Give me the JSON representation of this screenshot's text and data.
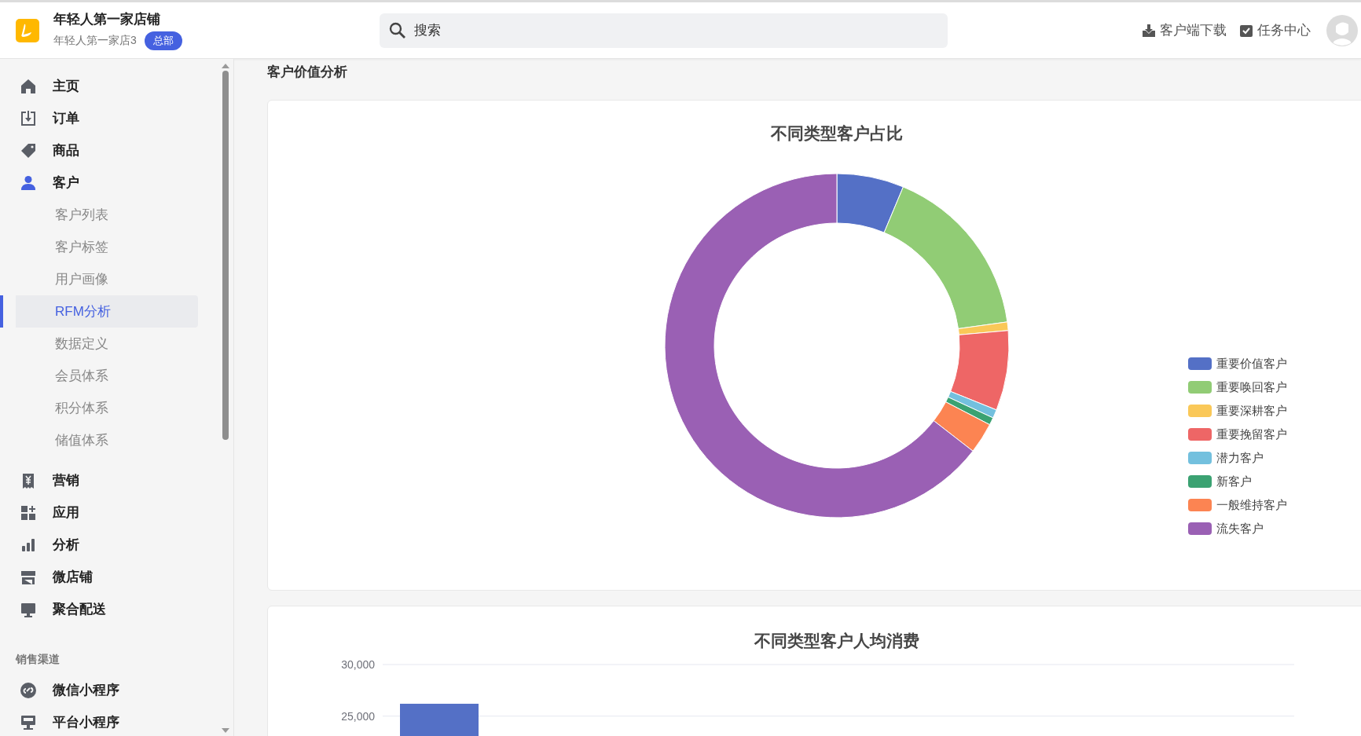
{
  "header": {
    "store_name": "年轻人第一家店铺",
    "branch": "年轻人第一家店3",
    "badge": "总部",
    "search": {
      "placeholder": "搜索"
    },
    "actions": [
      {
        "label": "客户端下载"
      },
      {
        "label": "任务中心"
      }
    ]
  },
  "sidebar": {
    "items": [
      {
        "label": "主页",
        "selected": false
      },
      {
        "label": "订单",
        "selected": false
      },
      {
        "label": "商品",
        "selected": false
      },
      {
        "label": "客户",
        "selected": false,
        "children": [
          {
            "label": "客户列表",
            "selected": false
          },
          {
            "label": "客户标签",
            "selected": false
          },
          {
            "label": "用户画像",
            "selected": false
          },
          {
            "label": "RFM分析",
            "selected": true
          },
          {
            "label": "数据定义",
            "selected": false
          },
          {
            "label": "会员体系",
            "selected": false
          },
          {
            "label": "积分体系",
            "selected": false
          },
          {
            "label": "储值体系",
            "selected": false
          }
        ]
      },
      {
        "label": "营销",
        "selected": false
      },
      {
        "label": "应用",
        "selected": false
      },
      {
        "label": "分析",
        "selected": false
      },
      {
        "label": "微店铺",
        "selected": false
      },
      {
        "label": "聚合配送",
        "selected": false
      }
    ],
    "channels": {
      "heading": "销售渠道",
      "items": [
        {
          "label": "微信小程序",
          "selected": false
        },
        {
          "label": "平台小程序",
          "selected": false
        }
      ]
    }
  },
  "page_title": "客户价值分析",
  "donut_card": {
    "title": "不同类型客户占比",
    "legend": [
      {
        "name": "重要价值客户",
        "color": "#5470c6"
      },
      {
        "name": "重要唤回客户",
        "color": "#91cc75"
      },
      {
        "name": "重要深耕客户",
        "color": "#fac858"
      },
      {
        "name": "重要挽留客户",
        "color": "#ee6666"
      },
      {
        "name": "潜力客户",
        "color": "#73c0de"
      },
      {
        "name": "新客户",
        "color": "#3ba272"
      },
      {
        "name": "一般维持客户",
        "color": "#fc8452"
      },
      {
        "name": "流失客户",
        "color": "#9a60b4"
      }
    ]
  },
  "bar_card": {
    "chart_data": {
      "type": "bar",
      "title": "不同类型客户人均消费",
      "ylim": [
        23000,
        30000
      ],
      "yticks": [
        {
          "value": 25000,
          "label": "25,000"
        },
        {
          "value": 30000,
          "label": "30,000"
        }
      ],
      "values": [
        26200
      ]
    }
  }
}
